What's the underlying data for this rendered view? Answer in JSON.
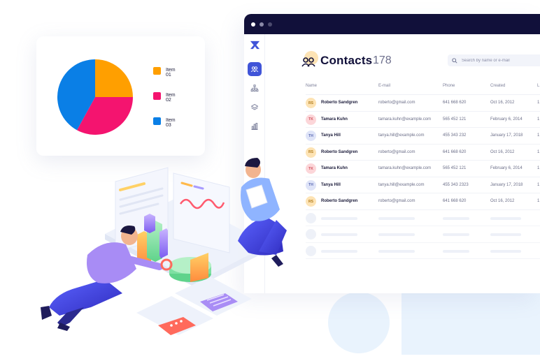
{
  "app": {
    "title": "Contacts",
    "count": "178",
    "search_placeholder": "Search by name or e-mail"
  },
  "sidebar": {
    "items": [
      {
        "icon": "users-icon",
        "active": true
      },
      {
        "icon": "hierarchy-icon",
        "active": false
      },
      {
        "icon": "layers-icon",
        "active": false
      },
      {
        "icon": "bar-chart-icon",
        "active": false
      }
    ]
  },
  "table": {
    "columns": [
      "Name",
      "E-mail",
      "Phone",
      "Created",
      "L"
    ],
    "rows": [
      {
        "initials": "RS",
        "name": "Roberto Sandgren",
        "email": "roberto@gmail.com",
        "phone": "641 668 620",
        "created": "Oct 16, 2012",
        "last": "1",
        "color": "yellow"
      },
      {
        "initials": "TK",
        "name": "Tamara Kuhn",
        "email": "tamara.kuhn@example.com",
        "phone": "565 452 121",
        "created": "February 6, 2014",
        "last": "1",
        "color": "pink"
      },
      {
        "initials": "TH",
        "name": "Tanya Hill",
        "email": "tanya.hill@example.com",
        "phone": "455  343 232",
        "created": "January 17, 2018",
        "last": "1",
        "color": "blue"
      },
      {
        "initials": "RS",
        "name": "Roberto Sandgren",
        "email": "roberto@gmail.com",
        "phone": "641 668 620",
        "created": "Oct 16, 2012",
        "last": "1",
        "color": "yellow"
      },
      {
        "initials": "TK",
        "name": "Tamara Kuhn",
        "email": "tamara.kuhn@example.com",
        "phone": "565 452 121",
        "created": "February 6, 2014",
        "last": "1",
        "color": "pink"
      },
      {
        "initials": "TH",
        "name": "Tanya Hill",
        "email": "tanya.hill@example.com",
        "phone": "455  343 2323",
        "created": "January 17, 2018",
        "last": "1",
        "color": "blue"
      },
      {
        "initials": "RS",
        "name": "Roberto Sandgren",
        "email": "roberto@gmail.com",
        "phone": "641 668 620",
        "created": "Oct 16, 2012",
        "last": "1",
        "color": "yellow"
      }
    ],
    "placeholder_rows": 3
  },
  "pie": {
    "items": [
      {
        "label": "Item 01",
        "value": 25,
        "color": "#ff9f00"
      },
      {
        "label": "Item 02",
        "value": 33,
        "color": "#f4146f"
      },
      {
        "label": "Item 03",
        "value": 42,
        "color": "#0a7fe6"
      }
    ]
  },
  "colors": {
    "accent": "#4054d8",
    "titlebar": "#11103a"
  }
}
